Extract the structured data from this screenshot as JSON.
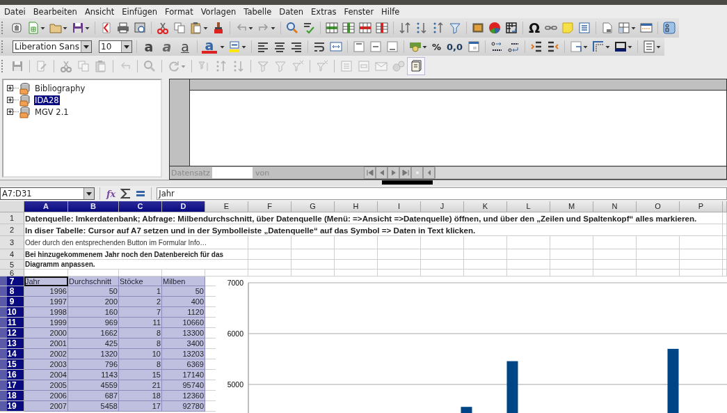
{
  "menu": [
    "Datei",
    "Bearbeiten",
    "Ansicht",
    "Einfügen",
    "Format",
    "Vorlagen",
    "Tabelle",
    "Daten",
    "Extras",
    "Fenster",
    "Hilfe"
  ],
  "standard_toolbar": {
    "special_character": "Ω"
  },
  "formatting_toolbar": {
    "font_name": "Liberation Sans",
    "font_size": "10",
    "bold": "a",
    "italic": "a",
    "underline": "a",
    "font_color": "a",
    "percent": "%",
    "decimal": "0,0"
  },
  "data_toolbar": {
    "explorer_on": true
  },
  "data_sources": [
    {
      "label": "Bibliography",
      "expanded": false,
      "selected": false
    },
    {
      "label": "IDA28",
      "expanded": false,
      "selected": true
    },
    {
      "label": "MGV 2.1",
      "expanded": false,
      "selected": false
    }
  ],
  "data_browser": {
    "record_label": "Datensatz",
    "of_label": "von"
  },
  "formula_bar": {
    "name_box": "A7:D31",
    "function_wizard": "fx",
    "value": "Jahr"
  },
  "sheet": {
    "columns": [
      {
        "label": "A",
        "selected": true
      },
      {
        "label": "B",
        "selected": true
      },
      {
        "label": "C",
        "selected": true
      },
      {
        "label": "D",
        "selected": true
      },
      {
        "label": "E",
        "selected": false
      },
      {
        "label": "F",
        "selected": false
      },
      {
        "label": "G",
        "selected": false
      },
      {
        "label": "H",
        "selected": false
      },
      {
        "label": "I",
        "selected": false
      },
      {
        "label": "J",
        "selected": false
      },
      {
        "label": "K",
        "selected": false
      },
      {
        "label": "L",
        "selected": false
      },
      {
        "label": "M",
        "selected": false
      },
      {
        "label": "N",
        "selected": false
      },
      {
        "label": "O",
        "selected": false
      },
      {
        "label": "P",
        "selected": false
      }
    ],
    "rows": [
      {
        "number": "1",
        "selected": false,
        "kind": "title",
        "text": "Datenquelle: Imkerdatenbank; Abfrage: Milbendurchschnitt, über Datenquelle (Menü: =>Ansicht =>Datenquelle) öffnen, und über den „Zeilen und Spaltenkopf“  alles markieren."
      },
      {
        "number": "2",
        "selected": false,
        "kind": "title",
        "text": "In diser Tabelle: Cursor auf A7 setzen und in der Symbolleiste „Datenquelle“ auf das Symbol => Daten in Text klicken."
      },
      {
        "number": "3",
        "selected": false,
        "kind": "hint",
        "text": "Oder durch den entsprechenden Button im Formular Info…"
      },
      {
        "number": "4",
        "selected": false,
        "kind": "remark",
        "text": "Bei hinzugekommenem Jahr noch den Datenbereich für das"
      },
      {
        "number": "5",
        "selected": false,
        "kind": "remark",
        "text": "Diagramm anpassen."
      },
      {
        "number": "6",
        "selected": false,
        "kind": "empty"
      },
      {
        "number": "7",
        "selected": true,
        "kind": "header",
        "cursor": true,
        "cells": [
          "Jahr",
          "Durchschnitt",
          "Stöcke",
          "Milben"
        ]
      },
      {
        "number": "8",
        "selected": true,
        "kind": "data",
        "cells": [
          "1996",
          "50",
          "1",
          "50"
        ]
      },
      {
        "number": "9",
        "selected": true,
        "kind": "data",
        "cells": [
          "1997",
          "200",
          "2",
          "400"
        ]
      },
      {
        "number": "10",
        "selected": true,
        "kind": "data",
        "cells": [
          "1998",
          "160",
          "7",
          "1120"
        ]
      },
      {
        "number": "11",
        "selected": true,
        "kind": "data",
        "cells": [
          "1999",
          "969",
          "11",
          "10660"
        ]
      },
      {
        "number": "12",
        "selected": true,
        "kind": "data",
        "cells": [
          "2000",
          "1662",
          "8",
          "13300"
        ]
      },
      {
        "number": "13",
        "selected": true,
        "kind": "data",
        "cells": [
          "2001",
          "425",
          "8",
          "3400"
        ]
      },
      {
        "number": "14",
        "selected": true,
        "kind": "data",
        "cells": [
          "2002",
          "1320",
          "10",
          "13203"
        ]
      },
      {
        "number": "15",
        "selected": true,
        "kind": "data",
        "cells": [
          "2003",
          "796",
          "8",
          "6369"
        ]
      },
      {
        "number": "16",
        "selected": true,
        "kind": "data",
        "cells": [
          "2004",
          "1143",
          "15",
          "17140"
        ]
      },
      {
        "number": "17",
        "selected": true,
        "kind": "data",
        "cells": [
          "2005",
          "4559",
          "21",
          "95740"
        ]
      },
      {
        "number": "18",
        "selected": true,
        "kind": "data",
        "cells": [
          "2006",
          "687",
          "18",
          "12360"
        ]
      },
      {
        "number": "19",
        "selected": true,
        "kind": "data",
        "cells": [
          "2007",
          "5458",
          "17",
          "92780"
        ]
      }
    ]
  },
  "chart": {
    "chart_data": {
      "type": "bar",
      "ylim": [
        4400,
        7000
      ],
      "yticks": [
        5000,
        6000,
        7000
      ],
      "series": [
        {
          "color": "#004586",
          "values": [
            null,
            null,
            null,
            null,
            null,
            null,
            null,
            null,
            null,
            4559,
            null,
            5458,
            null,
            null,
            null,
            null,
            null,
            null,
            5700,
            null,
            null
          ]
        }
      ]
    }
  }
}
